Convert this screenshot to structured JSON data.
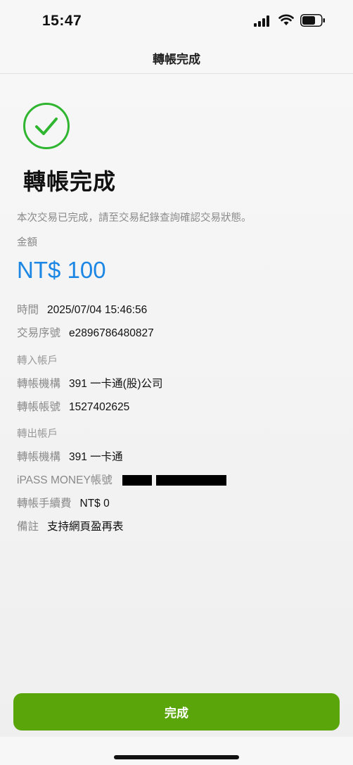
{
  "status_bar": {
    "time": "15:47"
  },
  "nav": {
    "title": "轉帳完成"
  },
  "result": {
    "title": "轉帳完成",
    "description": "本次交易已完成，請至交易紀錄查詢確認交易狀態。",
    "amount_label": "金額",
    "amount": "NT$ 100"
  },
  "details": {
    "time_label": "時間",
    "time_value": "2025/07/04 15:46:56",
    "txn_label": "交易序號",
    "txn_value": "e2896786480827",
    "in_section": "轉入帳戶",
    "in_bank_label": "轉帳機構",
    "in_bank_value": "391 一卡通(股)公司",
    "in_account_label": "轉帳帳號",
    "in_account_value": "1527402625",
    "out_section": "轉出帳戶",
    "out_bank_label": "轉帳機構",
    "out_bank_value": "391 一卡通",
    "ipass_label": "iPASS MONEY帳號",
    "fee_label": "轉帳手續費",
    "fee_value": "NT$ 0",
    "note_label": "備註",
    "note_value": "支持網頁盈再表"
  },
  "footer": {
    "done_label": "完成"
  },
  "colors": {
    "success": "#2fb52f",
    "amount": "#1b86e3",
    "button": "#5aa509"
  },
  "icons": {
    "result": "check-circle-icon",
    "signal": "cellular-signal-icon",
    "wifi": "wifi-icon",
    "battery": "battery-icon"
  }
}
